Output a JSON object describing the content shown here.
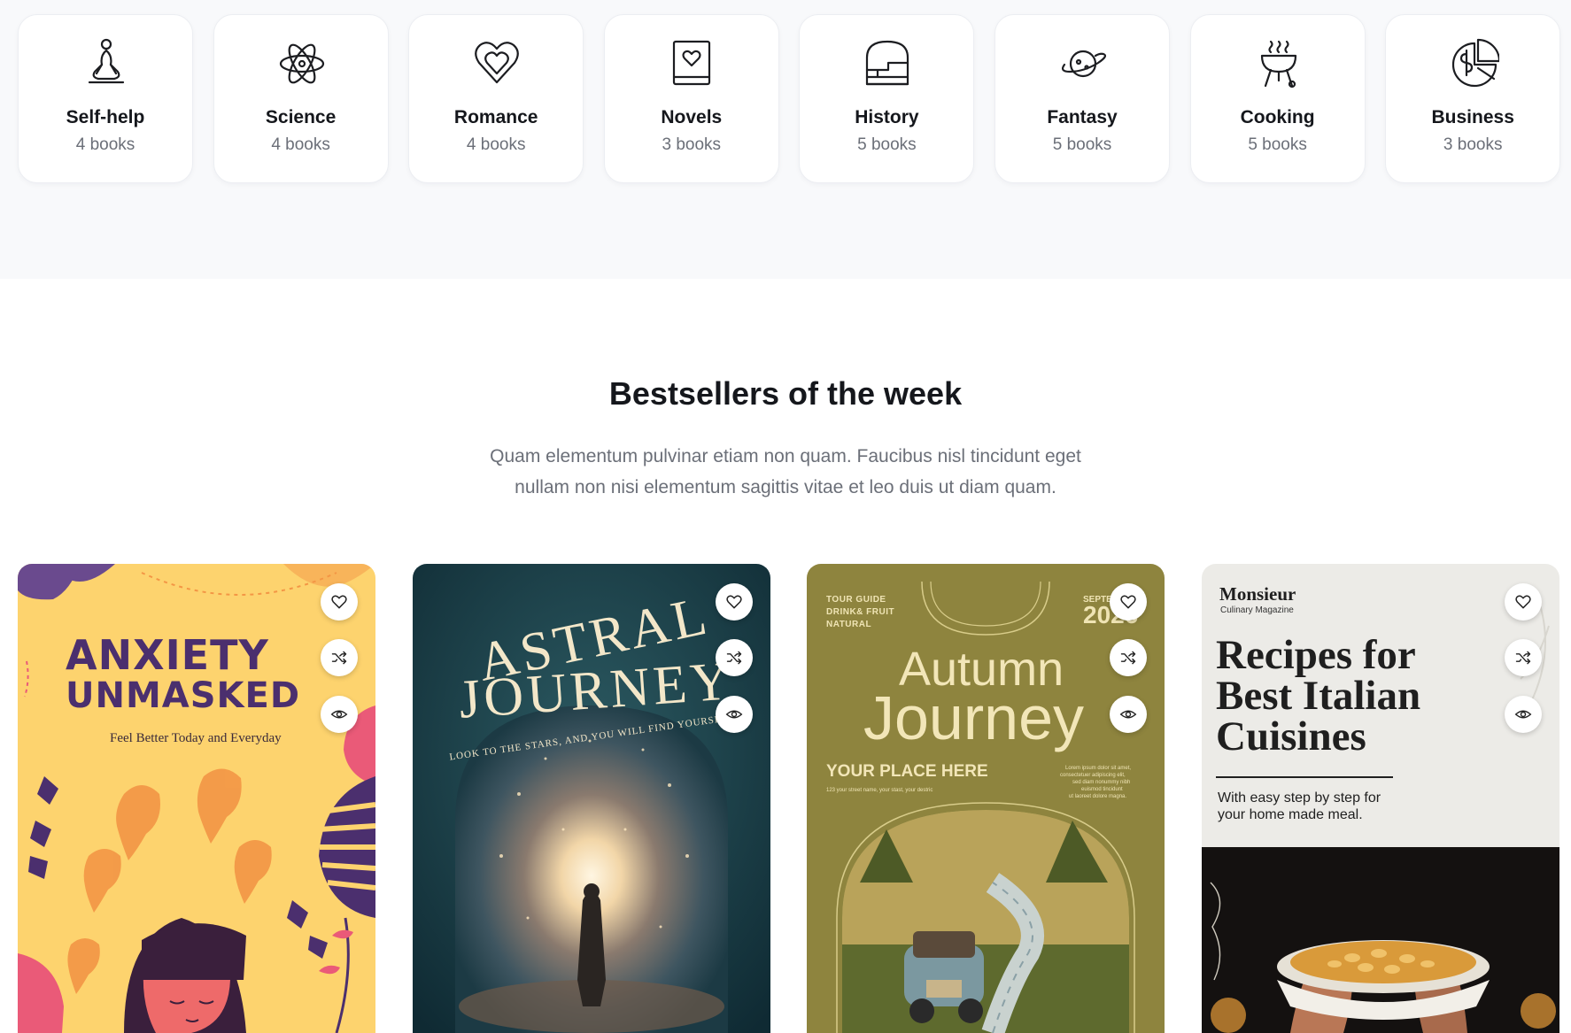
{
  "categories": [
    {
      "name": "Self-help",
      "count": "4 books",
      "icon": "meditation-icon"
    },
    {
      "name": "Science",
      "count": "4 books",
      "icon": "atom-icon"
    },
    {
      "name": "Romance",
      "count": "4 books",
      "icon": "heart-icon"
    },
    {
      "name": "Novels",
      "count": "3 books",
      "icon": "book-heart-icon"
    },
    {
      "name": "History",
      "count": "5 books",
      "icon": "ruins-icon"
    },
    {
      "name": "Fantasy",
      "count": "5 books",
      "icon": "planet-icon"
    },
    {
      "name": "Cooking",
      "count": "5 books",
      "icon": "grill-icon"
    },
    {
      "name": "Business",
      "count": "3 books",
      "icon": "pie-chart-dollar-icon"
    }
  ],
  "bestsellers": {
    "title": "Bestsellers of the week",
    "subtitle": "Quam elementum pulvinar etiam non quam. Faucibus nisl tincidunt eget nullam non nisi elementum sagittis vitae et leo duis ut diam quam."
  },
  "books": [
    {
      "title_line1": "ANXIETY",
      "title_line2": "UNMASKED",
      "tagline": "Feel Better Today and Everyday",
      "colors": {
        "bg": "#fdd36e",
        "ink": "#4b2f6e",
        "accent": "#f39645"
      }
    },
    {
      "title_line1": "ASTRAL",
      "title_line2": "JOURNEY",
      "arc_text": "LOOK TO THE STARS, AND YOU WILL FIND YOURSELF",
      "colors": {
        "bg": "#163a44",
        "ink": "#f3e7c9"
      }
    },
    {
      "top_left": [
        "TOUR GUIDE",
        "DRINK& FRUIT",
        "NATURAL"
      ],
      "top_right_small": "SEPTE",
      "top_right_big": "2026",
      "title_line1": "Autumn",
      "title_line2": "Journey",
      "place": "YOUR PLACE HERE",
      "address": "123 your street name, your stast, your destric",
      "blurb": [
        "Lorem ipsum dolor sit amet,",
        "consectetuer adipiscing elit,",
        "sed diam nonummy nibh",
        "euismod tincidunt",
        "ut laoreet dolore magna."
      ],
      "colors": {
        "bg": "#8e843e",
        "ink": "#f2e6b8"
      }
    },
    {
      "brand": "Monsieur",
      "brand_sub": "Culinary Magazine",
      "title_line1": "Recipes for",
      "title_line2": "Best Italian",
      "title_line3": "Cuisines",
      "tagline_line1": "With easy step by step for",
      "tagline_line2": "your home made meal.",
      "colors": {
        "bg": "#ecebe7",
        "ink": "#1f1f1f"
      }
    }
  ],
  "actions": {
    "wishlist": "heart-outline-icon",
    "compare": "shuffle-icon",
    "quick_view": "eye-icon"
  }
}
